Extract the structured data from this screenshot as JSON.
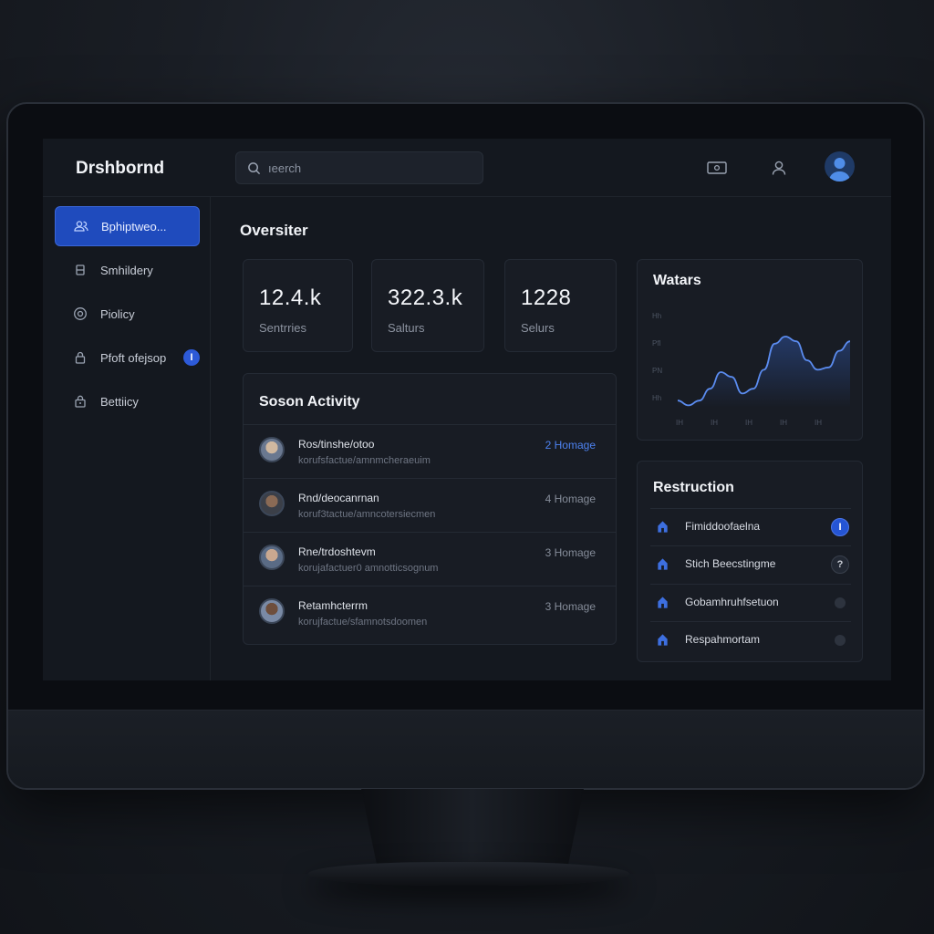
{
  "brand": "Drshbornd",
  "search": {
    "placeholder": "ıeerch"
  },
  "sidebar": {
    "items": [
      {
        "label": "Bphiptweo...",
        "icon": "users-icon",
        "active": true
      },
      {
        "label": "Smhildery",
        "icon": "box-icon"
      },
      {
        "label": "Piolicy",
        "icon": "target-icon"
      },
      {
        "label": "Pfoft ofejsop",
        "icon": "lock-icon",
        "badge": "I"
      },
      {
        "label": "Bettiicy",
        "icon": "lock-icon"
      }
    ]
  },
  "overview": {
    "title": "Oversiter",
    "stats": [
      {
        "value": "12.4.k",
        "label": "Sentrries"
      },
      {
        "value": "322.3.k",
        "label": "Salturs"
      },
      {
        "value": "1228",
        "label": "Selurs"
      }
    ]
  },
  "activity": {
    "title": "Soson Activity",
    "rows": [
      {
        "title": "Ros/tinshe/otoo",
        "subtitle": "korufsfactue/amnmcheraeuim",
        "meta": "2 Homage",
        "highlight": true
      },
      {
        "title": "Rnd/deocanrnan",
        "subtitle": "koruf3tactue/amncotersiecmen",
        "meta": "4 Homage",
        "highlight": false
      },
      {
        "title": "Rne/trdoshtevm",
        "subtitle": "korujafactuer0 amnotticsognum",
        "meta": "3 Homage",
        "highlight": false
      },
      {
        "title": "Retamhcterrm",
        "subtitle": "korujfactue/sfamnotsdoomen",
        "meta": "3 Homage",
        "highlight": false
      }
    ]
  },
  "chart_data": {
    "type": "area",
    "title": "Watars",
    "x": [
      0,
      1,
      2,
      3,
      4,
      5,
      6,
      7,
      8,
      9,
      10,
      11,
      12,
      13,
      14,
      15,
      16
    ],
    "values": [
      3,
      1,
      3,
      8,
      15,
      13,
      6,
      8,
      16,
      27,
      30,
      28,
      20,
      16,
      17,
      24,
      28
    ],
    "ylim": [
      0,
      40
    ],
    "ytick_labels": [
      "Hh",
      "PfI",
      "PN",
      "Hh"
    ],
    "xtick_labels": [
      "IH",
      "IH",
      "IH",
      "IH",
      "IH"
    ],
    "grid": false,
    "line_color": "#5b8cf0"
  },
  "restriction": {
    "title": "Restruction",
    "rows": [
      {
        "label": "Fimiddoofaelna",
        "status": "on",
        "status_text": "I"
      },
      {
        "label": "Stich Beecstingme",
        "status": "half",
        "status_text": "?"
      },
      {
        "label": "Gobamhruhfsetuon",
        "status": "off",
        "status_text": ""
      },
      {
        "label": "Respahmortam",
        "status": "off",
        "status_text": ""
      }
    ]
  },
  "colors": {
    "accent": "#1f4bbd",
    "background": "#14181f",
    "card": "#181c24"
  }
}
